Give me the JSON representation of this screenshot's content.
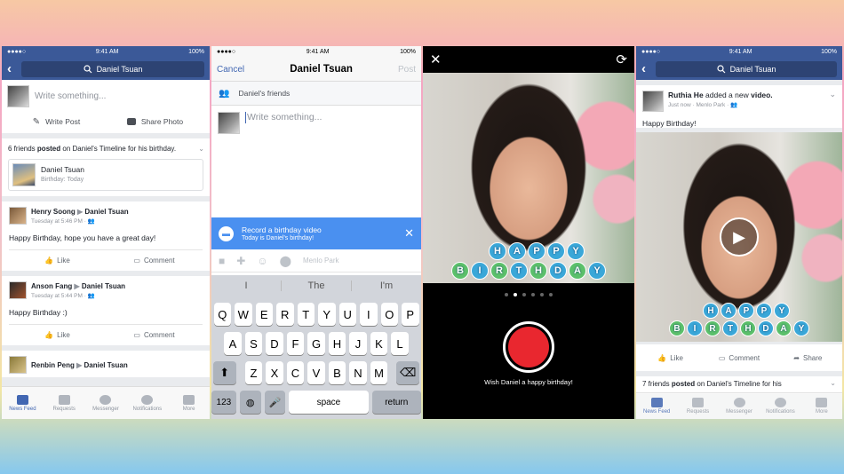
{
  "status_bar": {
    "carrier": "●●●●○",
    "time": "9:41 AM",
    "battery": "100%"
  },
  "panel1": {
    "search_name": "Daniel Tsuan",
    "composer_placeholder": "Write something...",
    "write_post": "Write Post",
    "share_photo": "Share Photo",
    "friends_posted_count": "6 friends",
    "friends_posted_bold": "posted",
    "friends_posted_rest": "on Daniel's Timeline for his birthday.",
    "birthday_name": "Daniel Tsuan",
    "birthday_sub": "Birthday: Today",
    "posts": [
      {
        "author": "Henry Soong",
        "target": "Daniel Tsuan",
        "time": "Tuesday at 5:46 PM",
        "text": "Happy Birthday, hope you have a great day!",
        "like": "Like",
        "comment": "Comment"
      },
      {
        "author": "Anson Fang",
        "target": "Daniel Tsuan",
        "time": "Tuesday at 5:44 PM",
        "text": "Happy Birthday :)",
        "like": "Like",
        "comment": "Comment"
      },
      {
        "author": "Renbin Peng",
        "target": "Daniel Tsuan"
      }
    ],
    "tabs": [
      "News Feed",
      "Requests",
      "Messenger",
      "Notifications",
      "More"
    ]
  },
  "panel2": {
    "cancel": "Cancel",
    "title": "Daniel Tsuan",
    "post": "Post",
    "audience": "Daniel's friends",
    "placeholder": "Write something...",
    "banner_title": "Record a birthday video",
    "banner_sub": "Today is Daniel's birthday!",
    "location": "Menlo Park",
    "suggestions": [
      "I",
      "The",
      "I'm"
    ],
    "keys_row1": [
      "Q",
      "W",
      "E",
      "R",
      "T",
      "Y",
      "U",
      "I",
      "O",
      "P"
    ],
    "keys_row2": [
      "A",
      "S",
      "D",
      "F",
      "G",
      "H",
      "J",
      "K",
      "L"
    ],
    "keys_row3": [
      "Z",
      "X",
      "C",
      "V",
      "B",
      "N",
      "M"
    ],
    "key_123": "123",
    "key_space": "space",
    "key_return": "return"
  },
  "panel3": {
    "happy": [
      "H",
      "A",
      "P",
      "P",
      "Y"
    ],
    "birthday": [
      "B",
      "I",
      "R",
      "T",
      "H",
      "D",
      "A",
      "Y"
    ],
    "caption": "Wish Daniel a happy birthday!",
    "colors": {
      "letter_blue": "#3aa7d8",
      "letter_green": "#5cc06b",
      "record": "#e9272f"
    }
  },
  "panel4": {
    "search_name": "Daniel Tsuan",
    "author": "Ruthia He",
    "action": "added a new",
    "action_bold": "video.",
    "time": "Just now",
    "place": "Menlo Park",
    "text": "Happy Birthday!",
    "like": "Like",
    "comment": "Comment",
    "share": "Share",
    "friends_posted_count": "7 friends",
    "friends_posted_bold": "posted",
    "friends_posted_rest": "on Daniel's Timeline for his",
    "tabs": [
      "News Feed",
      "Requests",
      "Messenger",
      "Notifications",
      "More"
    ]
  }
}
